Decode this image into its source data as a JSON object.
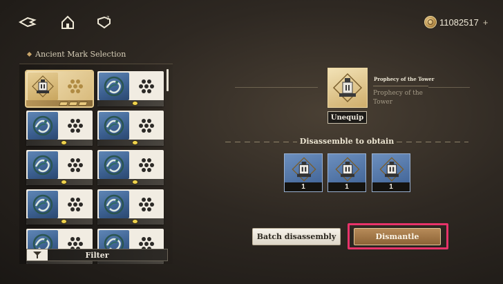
{
  "top_bar": {
    "back_icon": "back-arrow-icon",
    "home_icon": "home-icon",
    "help_icon": "help-icon",
    "currency_value": "11082517",
    "currency_plus": "+"
  },
  "left_panel": {
    "title": "Ancient Mark Selection",
    "filter_label": "Filter",
    "cards": [
      {
        "selected": true,
        "badge": "level-bars"
      },
      {
        "selected": false,
        "badge": "yellow"
      },
      {
        "selected": false,
        "badge": "yellow"
      },
      {
        "selected": false,
        "badge": "yellow"
      },
      {
        "selected": false,
        "badge": "yellow"
      },
      {
        "selected": false,
        "badge": "yellow"
      },
      {
        "selected": false,
        "badge": "yellow"
      },
      {
        "selected": false,
        "badge": "yellow"
      },
      {
        "selected": false,
        "badge": "none"
      },
      {
        "selected": false,
        "badge": "none"
      }
    ]
  },
  "right_panel": {
    "preview_name_small": "Prophecy of the Tower",
    "preview_name": "Prophecy of the Tower",
    "unequip_label": "Unequip",
    "obtain_title": "Disassemble to obtain",
    "rewards": [
      {
        "count": "1"
      },
      {
        "count": "1"
      },
      {
        "count": "1"
      }
    ],
    "batch_label": "Batch disassembly",
    "dismantle_label": "Dismantle"
  },
  "colors": {
    "highlight": "#e8336a",
    "accent_gold": "#c9a56a",
    "card_blue": "#4a6fa0"
  }
}
